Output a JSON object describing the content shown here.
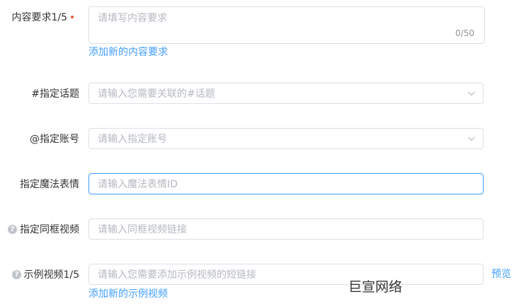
{
  "form": {
    "content_requirement": {
      "label": "内容要求1/5",
      "placeholder": "请填写内容要求",
      "counter": "0/50",
      "add_link": "添加新的内容要求"
    },
    "topic": {
      "label": "#指定话题",
      "placeholder": "请输入您需要关联的#话题"
    },
    "account": {
      "label": "@指定账号",
      "placeholder": "请输入指定账号"
    },
    "magic_emoji": {
      "label": "指定魔法表情",
      "placeholder": "请输入魔法表情ID"
    },
    "same_frame": {
      "label": "指定同框视频",
      "placeholder": "请输入同框视频链接"
    },
    "example_video": {
      "label": "示例视频1/5",
      "placeholder": "请输入您需要添加示例视频的短链接",
      "preview_link": "预览",
      "add_link": "添加新的示例视频"
    }
  },
  "icons": {
    "help": "?"
  },
  "watermark": "巨宣网络",
  "colors": {
    "accent": "#409eff",
    "required": "#e05a2b",
    "placeholder": "#b4b8c0",
    "border": "#dcdfe6"
  }
}
